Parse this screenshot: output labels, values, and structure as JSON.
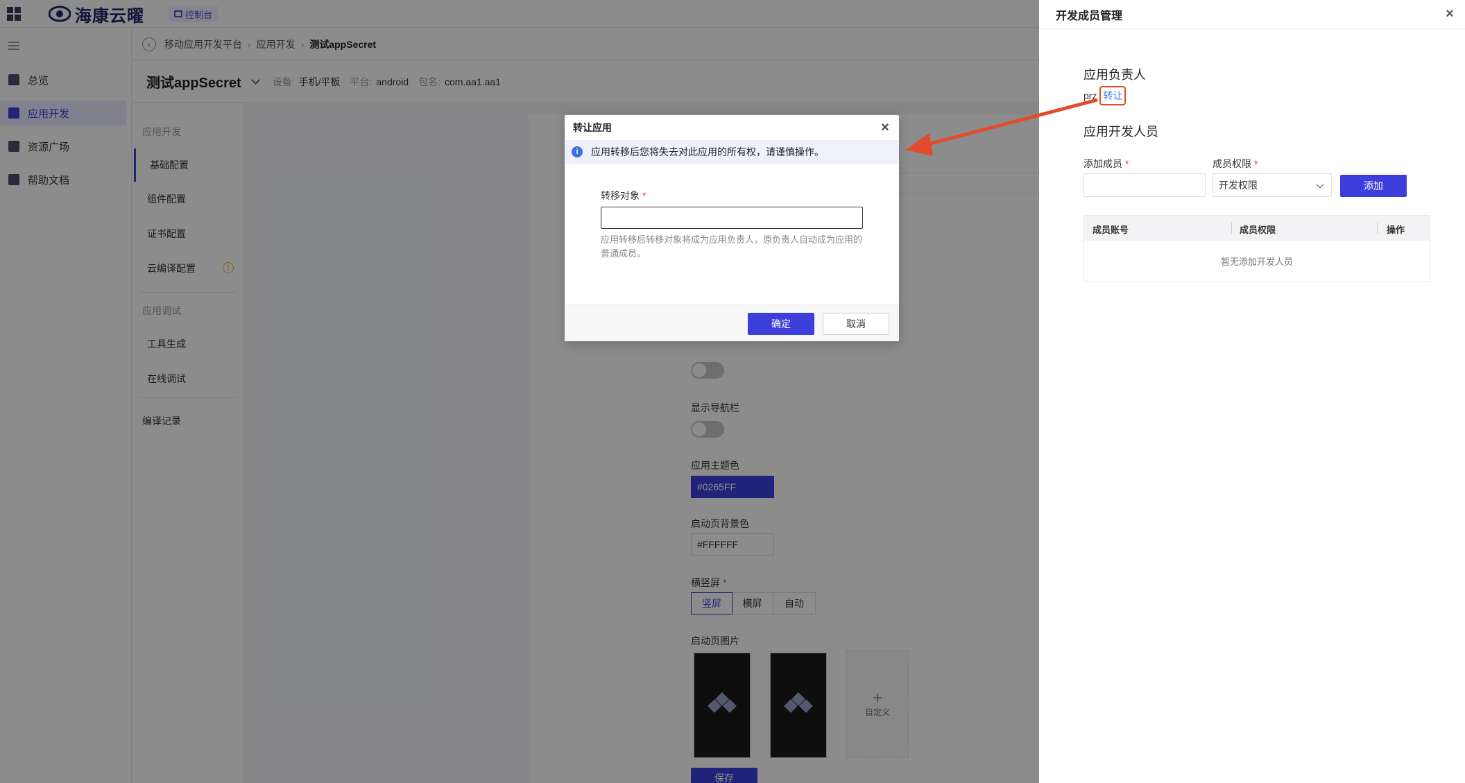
{
  "topbar": {
    "logo_text": "海康云曜",
    "console_label": "控制台"
  },
  "leftnav": {
    "items": [
      {
        "label": "总览",
        "icon": "grid-icon"
      },
      {
        "label": "应用开发",
        "icon": "monitor-icon"
      },
      {
        "label": "资源广场",
        "icon": "shop-icon"
      },
      {
        "label": "帮助文档",
        "icon": "document-icon"
      }
    ]
  },
  "breadcrumb": {
    "items": [
      "移动应用开发平台",
      "应用开发",
      "测试appSecret"
    ]
  },
  "app_header": {
    "title": "测试appSecret",
    "device_key": "设备:",
    "device_value": "手机/平板",
    "platform_key": "平台:",
    "platform_value": "android",
    "package_key": "包名:",
    "package_value": "com.aa1.aa1"
  },
  "subnav": {
    "group1": "应用开发",
    "items1": [
      "基础配置",
      "组件配置",
      "证书配置",
      "云编译配置"
    ],
    "group2": "应用调试",
    "items2": [
      "工具生成",
      "在线调试"
    ],
    "build_record": "编译记录"
  },
  "form": {
    "show_nav_label": "显示导航栏",
    "theme_color_label": "应用主题色",
    "theme_color_value": "#0265FF",
    "splash_bg_label": "启动页背景色",
    "splash_bg_value": "#FFFFFF",
    "orientation_label": "横竖屏",
    "orientation_options": [
      "竖屏",
      "横屏",
      "自动"
    ],
    "orientation_selected": "竖屏",
    "splash_image_label": "启动页图片",
    "custom_label": "自定义",
    "save_label": "保存"
  },
  "drawer": {
    "title": "开发成员管理",
    "owner_title": "应用负责人",
    "owner_name": "prz",
    "transfer_link": "转让",
    "dev_title": "应用开发人员",
    "add_member_label": "添加成员",
    "permission_label": "成员权限",
    "permission_value": "开发权限",
    "add_button": "添加",
    "table_headers": [
      "成员账号",
      "成员权限",
      "操作"
    ],
    "empty_text": "暂无添加开发人员"
  },
  "modal": {
    "title": "转让应用",
    "alert": "应用转移后您将失去对此应用的所有权，请谨慎操作。",
    "field_label": "转移对象",
    "input_value": "",
    "help_text": "应用转移后转移对象将成为应用负责人，原负责人自动成为应用的普通成员。",
    "ok_label": "确定",
    "cancel_label": "取消"
  },
  "colors": {
    "accent": "#3d3fdc",
    "annotation_red": "#e24b2c",
    "link_blue": "#3d7be0"
  }
}
